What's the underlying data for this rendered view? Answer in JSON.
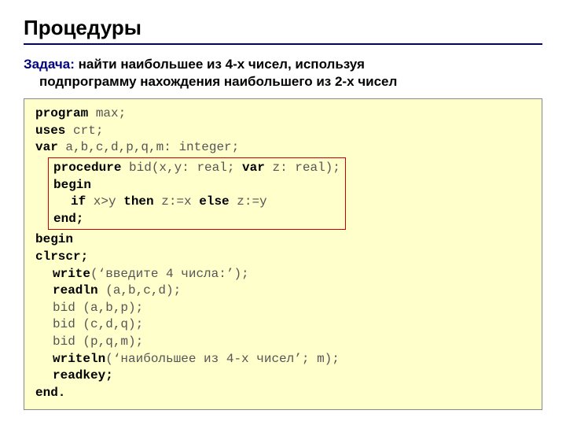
{
  "title": "Процедуры",
  "task": {
    "label": "Задача:",
    "line1": " найти наибольшее из 4-х чисел, используя",
    "line2": "подпрограмму нахождения наибольшего из 2-х чисел"
  },
  "code": {
    "l1_kw": "program",
    "l1_rest": " max;",
    "l2_kw": "uses",
    "l2_rest": " crt;",
    "l3_kw": "var",
    "l3_rest": " a,b,c,d,p,q,m: integer;",
    "l4_kw": "procedure",
    "l4_rest": " bid(x,y: real; ",
    "l4_kw2": "var",
    "l4_rest2": " z: real);",
    "l5_kw": "begin",
    "l6_kw": "if",
    "l6_rest": " x>y ",
    "l6_kw2": "then",
    "l6_rest2": " z:=x ",
    "l6_kw3": "else",
    "l6_rest3": " z:=y",
    "l7_kw": "end;",
    "l8_kw": "begin",
    "l9_kw": "clrscr;",
    "l10_kw": "write",
    "l10_rest": "(‘введите 4 числа:’);",
    "l11_kw": "readln",
    "l11_rest": " (a,b,c,d);",
    "l12": "bid (a,b,p);",
    "l13": "bid (c,d,q);",
    "l14": "bid (p,q,m);",
    "l15_kw": "writeln",
    "l15_rest": "(‘наибольшее из 4-х чисел’; m);",
    "l16_kw": "readkey;",
    "l17_kw": "end."
  }
}
